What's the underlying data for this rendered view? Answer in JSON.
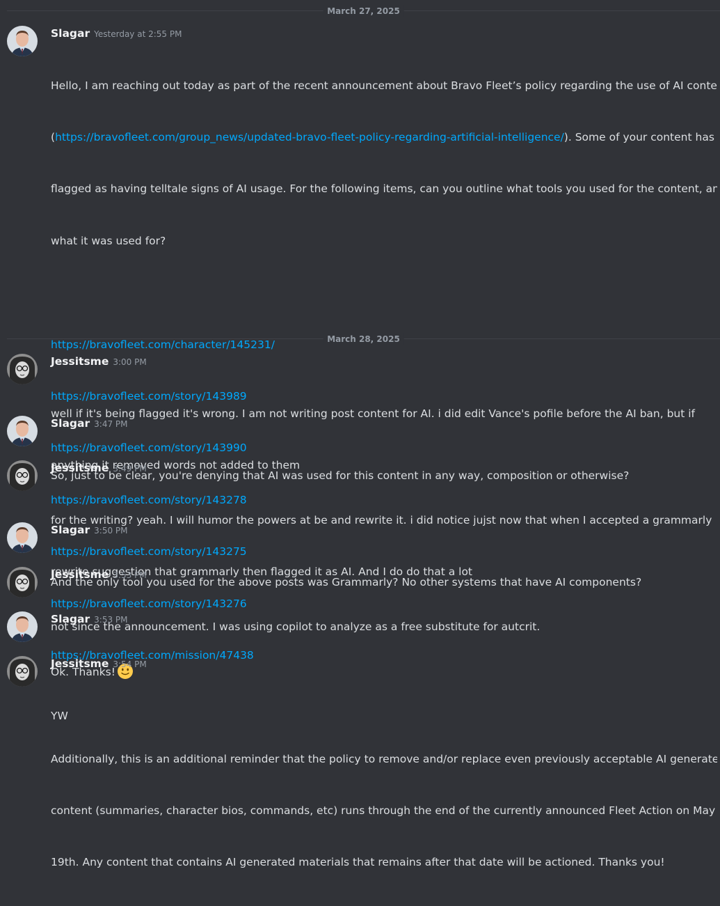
{
  "dividers": {
    "d1": "March 27, 2025",
    "d2": "March 28, 2025"
  },
  "messages": {
    "m1": {
      "author": "Slagar",
      "time": "Yesterday at 2:55 PM",
      "l1": "Hello, I am reaching out today as part of the recent announcement about Bravo Fleet’s policy regarding the use of AI content",
      "l2_pre": "(",
      "l2_link": "https://bravofleet.com/group_news/updated-bravo-fleet-policy-regarding-artificial-intelligence/",
      "l2_post": "). Some of your content has",
      "l3": "flagged as having telltale signs of AI usage. For the following items, can you outline what tools you used for the content, and",
      "l4": "what it was used for?",
      "links": [
        "https://bravofleet.com/character/145231/",
        "https://bravofleet.com/story/143989",
        "https://bravofleet.com/story/143990",
        "https://bravofleet.com/story/143278",
        "https://bravofleet.com/story/143275",
        "https://bravofleet.com/story/143276",
        "https://bravofleet.com/mission/47438"
      ],
      "p1": "Additionally, this is an additional reminder that the policy to remove and/or replace even previously acceptable AI generated",
      "p2": "content (summaries, character bios, commands, etc) runs through the end of the currently announced Fleet Action on May",
      "p3": "19th. Any content that contains AI generated materials that remains after that date will be actioned. Thanks you!"
    },
    "m2": {
      "author": "Jessitsme",
      "time": "3:00 PM",
      "l1": "well if it's being flagged it's wrong.  I am not writing post content for AI.  i did edit Vance's pofile before the AI ban, but if",
      "l2": "anything it removed words not added to them"
    },
    "m3": {
      "author": "Slagar",
      "time": "3:47 PM",
      "l1": "So, just to be clear, you're denying that AI was used for this content in any way, composition or otherwise?"
    },
    "m4": {
      "author": "Jessitsme",
      "time": "3:49 PM",
      "l1": "for the writing? yeah.  I will humor the powers at be and rewrite it.  i did notice jujst now that when I accepted a grammarly",
      "l2": "rewrite suggestion that grammarly then flagged it as AI. And I do do that a lot"
    },
    "m5": {
      "author": "Slagar",
      "time": "3:50 PM",
      "l1": "And the only tool you used for the above posts was Grammarly? No other systems that have AI components?"
    },
    "m6": {
      "author": "Jessitsme",
      "time": "3:53 PM",
      "l1": "not since the announcement.  I was using copilot to analyze as a free substitute for autcrit."
    },
    "m7": {
      "author": "Slagar",
      "time": "3:53 PM",
      "l1": "Ok. Thanks!",
      "emoji": "slightly-smiling-face-icon"
    },
    "m8": {
      "author": "Jessitsme",
      "time": "3:54 PM",
      "l1": "YW"
    }
  },
  "colors": {
    "background": "#313338",
    "text": "#dbdee1",
    "username": "#f2f3f5",
    "timestamp": "#949ba4",
    "link": "#00a8fc"
  }
}
